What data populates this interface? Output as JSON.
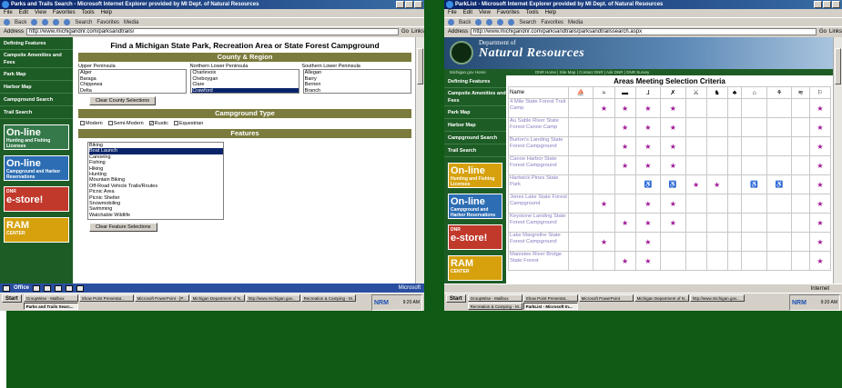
{
  "left_window": {
    "title": "Parks and Trails Search - Microsoft Internet Explorer provided by MI Dept. of Natural Resources",
    "menu": [
      "File",
      "Edit",
      "View",
      "Favorites",
      "Tools",
      "Help"
    ],
    "toolbar": [
      "Back",
      "Search",
      "Favorites",
      "Media"
    ],
    "address_label": "Address",
    "address": "http://www.michigandnr.com/parksandtrails/",
    "go_label": "Go",
    "links_label": "Links",
    "nav": [
      "Defining Features",
      "Campsite Amenities and Fees",
      "Park Map",
      "Harbor Map",
      "Campground Search",
      "Trail Search"
    ],
    "promos": [
      {
        "big": "On-line",
        "small": "Hunting and Fishing Licenses"
      },
      {
        "big": "On-line",
        "small": "Campground and Harbor Reservations"
      },
      {
        "big": "e-store!",
        "small": "DNR"
      },
      {
        "big": "RAM",
        "small": "CENTER"
      }
    ],
    "page_title": "Find a Michigan State Park, Recreation Area or State Forest Campground",
    "county_header": "County & Region",
    "regions": [
      {
        "name": "Upper Peninsula",
        "items": [
          "Alger",
          "Baraga",
          "Chippewa",
          "Delta"
        ],
        "selected": -1
      },
      {
        "name": "Northern Lower Peninsula",
        "items": [
          "Charlevoix",
          "Cheboygan",
          "Clare",
          "Crawford"
        ],
        "selected": 3
      },
      {
        "name": "Southern Lower Peninsula",
        "items": [
          "Allegan",
          "Barry",
          "Berrien",
          "Branch"
        ],
        "selected": -1
      }
    ],
    "clear_county": "Clear County Selections",
    "campground_header": "Campground Type",
    "campground_types": [
      {
        "label": "Modern",
        "checked": false
      },
      {
        "label": "Semi-Modern",
        "checked": false
      },
      {
        "label": "Rustic",
        "checked": true
      },
      {
        "label": "Equestrian",
        "checked": false
      }
    ],
    "features_header": "Features",
    "features": [
      "Biking",
      "Boat Launch",
      "Canoeing",
      "Fishing",
      "Hiking",
      "Hunting",
      "Mountain Biking",
      "Off-Road Vehicle Trails/Routes",
      "Picnic Area",
      "Picnic Shelter",
      "Snowmobiling",
      "Swimming",
      "Watchable Wildlife"
    ],
    "features_selected": 1,
    "clear_features": "Clear Feature Selections",
    "office_label": "Office",
    "office_right": "Microsoft",
    "start_label": "Start",
    "tasks": [
      "GroupWise - Mailbox",
      "Show Point Presentat...",
      "Microsoft PowerPoint - [P...",
      "Michigan Department of N...",
      "http://www.michigan.gov...",
      "Recreation & Camping - M...",
      "Parks and Trails Searc..."
    ],
    "active_task": 6,
    "tray_logo": "NRM",
    "clock": "9:20 AM"
  },
  "right_window": {
    "title": "ParkList - Microsoft Internet Explorer provided by MI Dept. of Natural Resources",
    "menu": [
      "File",
      "Edit",
      "View",
      "Favorites",
      "Tools",
      "Help"
    ],
    "toolbar": [
      "Back",
      "Search",
      "Favorites",
      "Media"
    ],
    "address_label": "Address",
    "address": "http://www.michigandnr.com/parksandtrails/parksandtrailssearch.aspx",
    "go_label": "Go",
    "links_label": "Links",
    "dept_line": "Department of",
    "agency_name": "Natural Resources",
    "home_link": "Michigan.gov Home",
    "top_links": "DNR Home | Site Map | Contact DNR | Ask DNR | DNR Survey",
    "nav": [
      "Defining Features",
      "Campsite Amenities and Fees",
      "Park Map",
      "Harbor Map",
      "Campground Search",
      "Trail Search"
    ],
    "promos": [
      {
        "big": "On-line",
        "small": "Hunting and Fishing Licenses"
      },
      {
        "big": "On-line",
        "small": "Campground and Harbor Reservations"
      },
      {
        "big": "e-store!",
        "small": "DNR"
      },
      {
        "big": "RAM",
        "small": "CENTER"
      }
    ],
    "table_title": "Areas Meeting Selection Criteria",
    "name_header": "Name",
    "feature_icons": [
      "boat-launch-icon",
      "canoe-icon",
      "fishing-icon",
      "hiking-icon",
      "hunting-icon",
      "mountain-bike-icon",
      "orv-icon",
      "picnic-area-icon",
      "picnic-shelter-icon",
      "snowmobile-icon",
      "swimming-icon",
      "wildlife-icon"
    ],
    "feature_glyphs": [
      "⛵",
      "≈",
      "▬",
      "⅃",
      "✗",
      "⚔",
      "♞",
      "♣",
      "⌂",
      "⚘",
      "≋",
      "⚐"
    ],
    "rows": [
      {
        "name": "4 Mile State Forest Trail Camp",
        "cells": [
          "",
          "★",
          "★",
          "★",
          "★",
          "",
          "",
          "",
          "",
          "",
          "",
          "★"
        ]
      },
      {
        "name": "Au Sable River State Forest Canoe Camp",
        "cells": [
          "",
          "",
          "★",
          "★",
          "★",
          "",
          "",
          "",
          "",
          "",
          "",
          "★"
        ]
      },
      {
        "name": "Burton's Landing State Forest Campground",
        "cells": [
          "",
          "",
          "★",
          "★",
          "★",
          "",
          "",
          "",
          "",
          "",
          "",
          "★"
        ]
      },
      {
        "name": "Canoe Harbor State Forest Campground",
        "cells": [
          "",
          "",
          "★",
          "★",
          "★",
          "",
          "",
          "",
          "",
          "",
          "",
          "★"
        ]
      },
      {
        "name": "Hartwick Pines State Park",
        "cells": [
          "",
          "",
          "",
          "♿",
          "♿",
          "★",
          "★",
          "",
          "♿",
          "♿",
          "",
          "★"
        ]
      },
      {
        "name": "Jones Lake State Forest Campground",
        "cells": [
          "",
          "★",
          "",
          "★",
          "★",
          "",
          "",
          "",
          "",
          "",
          "",
          "★"
        ]
      },
      {
        "name": "Keystone Landing State Forest Campground",
        "cells": [
          "",
          "",
          "★",
          "★",
          "★",
          "",
          "",
          "",
          "",
          "",
          "",
          "★"
        ]
      },
      {
        "name": "Lake Margrethe State Forest Campground",
        "cells": [
          "",
          "★",
          "",
          "★",
          "",
          "",
          "",
          "",
          "",
          "",
          "",
          "★"
        ]
      },
      {
        "name": "Manistee River Bridge State Forest",
        "cells": [
          "",
          "",
          "★",
          "★",
          "",
          "",
          "",
          "",
          "",
          "",
          "",
          "★"
        ]
      }
    ],
    "status_zone": "Internet",
    "start_label": "Start",
    "tasks": [
      "GroupWise - Mailbox",
      "Show Point Presentat...",
      "Microsoft PowerPoint",
      "Michigan Department of N...",
      "http://www.michigan.gov...",
      "Recreation & Camping - M...",
      "ParkList - Microsoft In..."
    ],
    "active_task": 6,
    "tray_logo": "NRM",
    "clock": "9:20 AM"
  },
  "colors": {
    "slide_background": "#0f5a14",
    "dnr_nav_green": "#1e5c26",
    "section_bar": "#7b7b3d",
    "star": "#a01897",
    "park_link": "#8a79bf"
  }
}
